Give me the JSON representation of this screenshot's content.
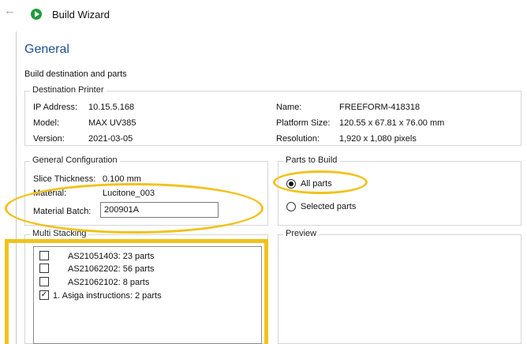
{
  "window": {
    "title": "Build Wizard"
  },
  "page": {
    "title": "General",
    "caption": "Build destination and parts"
  },
  "destination": {
    "legend": "Destination Printer",
    "ip_label": "IP Address:",
    "ip_value": "10.15.5.168",
    "model_label": "Model:",
    "model_value": "MAX UV385",
    "version_label": "Version:",
    "version_value": "2021-03-05",
    "name_label": "Name:",
    "name_value": "FREEFORM-418318",
    "platform_label": "Platform Size:",
    "platform_value": "120.55 x 67.81 x 76.00 mm",
    "resolution_label": "Resolution:",
    "resolution_value": "1,920 x 1,080 pixels"
  },
  "config": {
    "legend": "General Configuration",
    "slice_label": "Slice Thickness:",
    "slice_value": "0.100 mm",
    "material_label": "Material:",
    "material_value": "Lucitone_003",
    "batch_label": "Material Batch:",
    "batch_value": "200901A"
  },
  "parts": {
    "legend": "Parts to Build",
    "all_label": "All parts",
    "selected_label": "Selected parts",
    "selected_option": "All parts"
  },
  "stacking": {
    "legend": "Multi Stacking",
    "items": [
      {
        "label": "AS21051403: 23 parts",
        "checked": false
      },
      {
        "label": "AS21062202: 56 parts",
        "checked": false
      },
      {
        "label": "AS21062102: 8 parts",
        "checked": false
      },
      {
        "label": "1.  Asiga instructions: 2 parts",
        "checked": true
      }
    ]
  },
  "preview": {
    "legend": "Preview"
  },
  "colors": {
    "accent": "#1e4f91",
    "annotation": "#f2c21b",
    "brand_icon": "#1f9d3a"
  }
}
